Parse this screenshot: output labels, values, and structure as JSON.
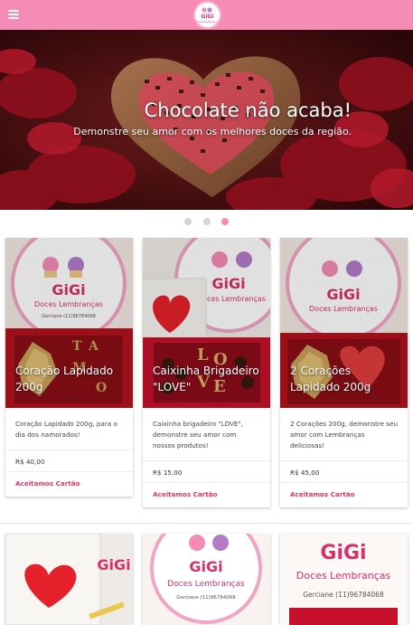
{
  "header": {
    "menu_icon": "hamburger-icon",
    "logo": {
      "line1": "GiGi",
      "line2": "Doces Lembranças"
    },
    "brand_color": "#f48cb6"
  },
  "hero": {
    "title": "Chocolate não acaba!",
    "subtitle": "Demonstre seu amor com os melhores doces da região.",
    "slides_count": 3,
    "active_slide": 3
  },
  "products": [
    {
      "title": "Coração Lapidado 200g",
      "description": "Coração Lapidado 200g, para o dia dos namorados!",
      "price": "R$ 40,00",
      "action": "Aceitamos Cartão"
    },
    {
      "title": "Caixinha Brigadeiro \"LOVE\"",
      "description": "Caixinha brigadeiro \"LOVE\", demonstre seu amor com nossos produtos!",
      "price": "R$ 15,00",
      "action": "Aceitamos Cartão"
    },
    {
      "title": "2 Corações Lapidado 200g",
      "description": "2 Corações 200g, demonstre seu amor com Lembranças deliciosas!",
      "price": "R$ 45,00",
      "action": "Aceitamos Cartão"
    }
  ],
  "product_image_text": {
    "brand": "GiGi",
    "tagline": "Doces Lembranças",
    "contact": "Gerciane (11)96784068",
    "box_letters": [
      "T",
      "A",
      "M",
      "O"
    ],
    "love_letters": [
      "L",
      "O",
      "V",
      "E"
    ]
  },
  "colors": {
    "accent": "#e8345f",
    "pink": "#f48cb6",
    "card_pink": "#d8306a"
  }
}
